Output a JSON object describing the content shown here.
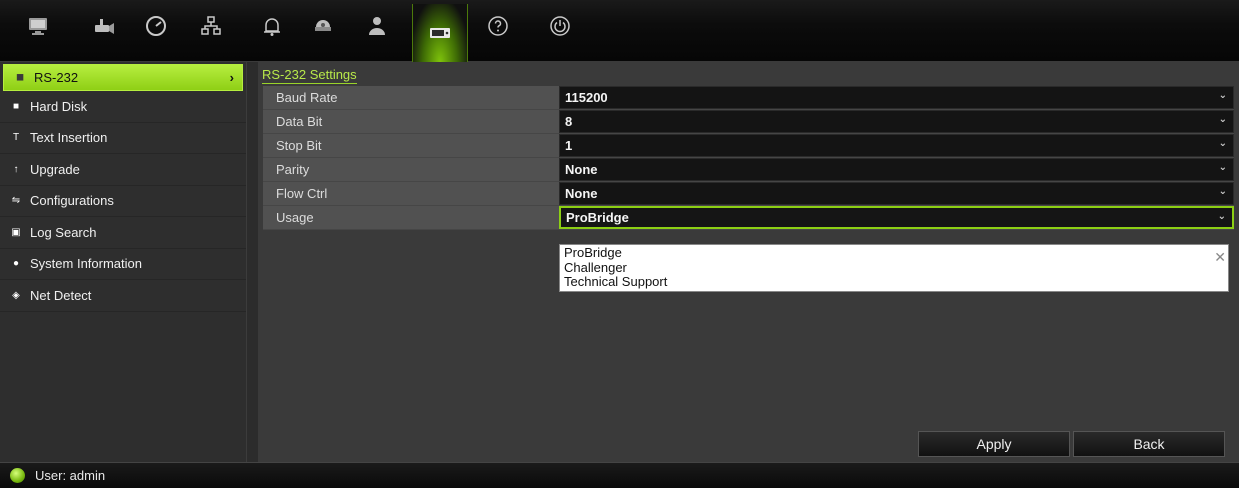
{
  "toolbar": {
    "icons": [
      "display-icon",
      "camera-icon",
      "gauge-icon",
      "network-icon",
      "alarm-bell-icon",
      "dome-camera-icon",
      "user-icon",
      "device-management-icon",
      "help-icon",
      "power-icon"
    ],
    "active": "device-management-icon"
  },
  "sidebar": {
    "items": [
      {
        "label": "RS-232",
        "icon": "rs232-icon"
      },
      {
        "label": "Hard Disk",
        "icon": "hard-disk-icon"
      },
      {
        "label": "Text Insertion",
        "icon": "text-insertion-icon"
      },
      {
        "label": "Upgrade",
        "icon": "upgrade-icon"
      },
      {
        "label": "Configurations",
        "icon": "configurations-icon"
      },
      {
        "label": "Log Search",
        "icon": "log-search-icon"
      },
      {
        "label": "System Information",
        "icon": "info-icon"
      },
      {
        "label": "Net Detect",
        "icon": "net-detect-icon"
      }
    ],
    "arrow": "›"
  },
  "main": {
    "title": "RS-232 Settings",
    "fields": [
      {
        "label": "Baud Rate",
        "value": "115200"
      },
      {
        "label": "Data Bit",
        "value": "8"
      },
      {
        "label": "Stop Bit",
        "value": "1"
      },
      {
        "label": "Parity",
        "value": "None"
      },
      {
        "label": "Flow Ctrl",
        "value": "None"
      },
      {
        "label": "Usage",
        "value": "ProBridge"
      }
    ],
    "usage_options": [
      "ProBridge",
      "Challenger",
      "Technical Support"
    ],
    "apply_label": "Apply",
    "back_label": "Back"
  },
  "status": {
    "user_text": "User: admin"
  },
  "colors": {
    "accent": "#9ad42a",
    "active_bg": "#b6ee3f"
  }
}
